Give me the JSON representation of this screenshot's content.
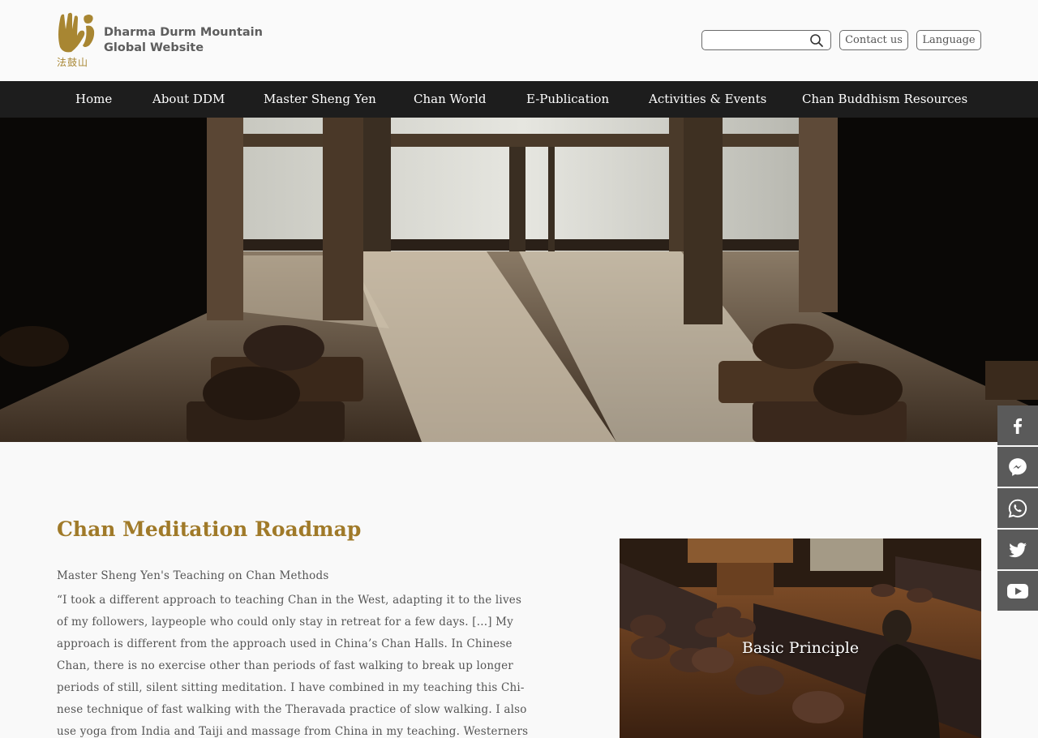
{
  "site": {
    "title_line1": "Dharma Durm Mountain",
    "title_line2": "Global Website",
    "logo_cn": "法鼓山",
    "brand_color": "#a88632"
  },
  "header": {
    "search_placeholder": "",
    "contact_label": "Contact us",
    "language_label": "Language"
  },
  "nav": {
    "items": [
      {
        "label": "Home"
      },
      {
        "label": "About DDM"
      },
      {
        "label": "Master Sheng Yen"
      },
      {
        "label": "Chan World"
      },
      {
        "label": "E-Publication"
      },
      {
        "label": "Activities & Events"
      },
      {
        "label": "Chan Buddhism Resources"
      }
    ]
  },
  "main": {
    "title": "Chan Meditation Roadmap",
    "subtitle": "Master Sheng Yen's Teaching on Chan Methods",
    "body_lines": [
      "“I took a different approach to teaching Chan in the West, adapting it to the lives",
      "of my followers, laypeople who could only stay in retreat for a few days. [...] My",
      "approach is different from the approach used in China’s Chan Halls. In Chinese",
      "Chan, there is no exercise other than periods of fast walking to break up longer",
      "periods of still, silent sitting meditation. I have combined in my teaching this Chi-",
      "nese technique of fast walking with the Theravada practice of slow walking. I also",
      "use yoga from India and Taiji and massage from China in my teaching. Westerners"
    ],
    "card_label": "Basic Principle"
  },
  "social": [
    {
      "icon": "facebook-icon"
    },
    {
      "icon": "messenger-icon"
    },
    {
      "icon": "whatsapp-icon"
    },
    {
      "icon": "twitter-icon"
    },
    {
      "icon": "youtube-icon"
    }
  ]
}
